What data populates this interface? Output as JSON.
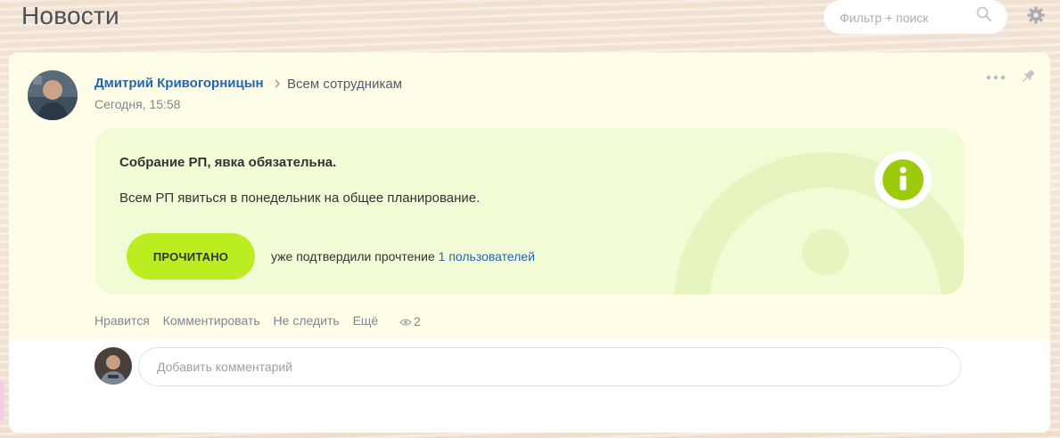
{
  "header": {
    "title": "Новости",
    "search_placeholder": "Фильтр + поиск"
  },
  "post": {
    "author": "Дмитрий Кривогорницын",
    "recipient": "Всем сотрудникам",
    "time": "Сегодня, 15:58",
    "notice": {
      "title": "Собрание РП, явка обязательна.",
      "body": "Всем РП явиться в понедельник на общее планирование.",
      "read_button": "ПРОЧИТАНО",
      "confirm_text": "уже подтвердили прочтение",
      "confirm_link": "1 пользователей"
    },
    "actions": {
      "like": "Нравится",
      "comment": "Комментировать",
      "unfollow": "Не следить",
      "more": "Ещё"
    },
    "views": "2",
    "comment_placeholder": "Добавить комментарий"
  },
  "colors": {
    "accent_green": "#bbed21",
    "link_blue": "#2067b0",
    "card_bg": "#fffde8",
    "notice_bg": "#f1fbd6",
    "info_icon": "#9dcb0c"
  }
}
